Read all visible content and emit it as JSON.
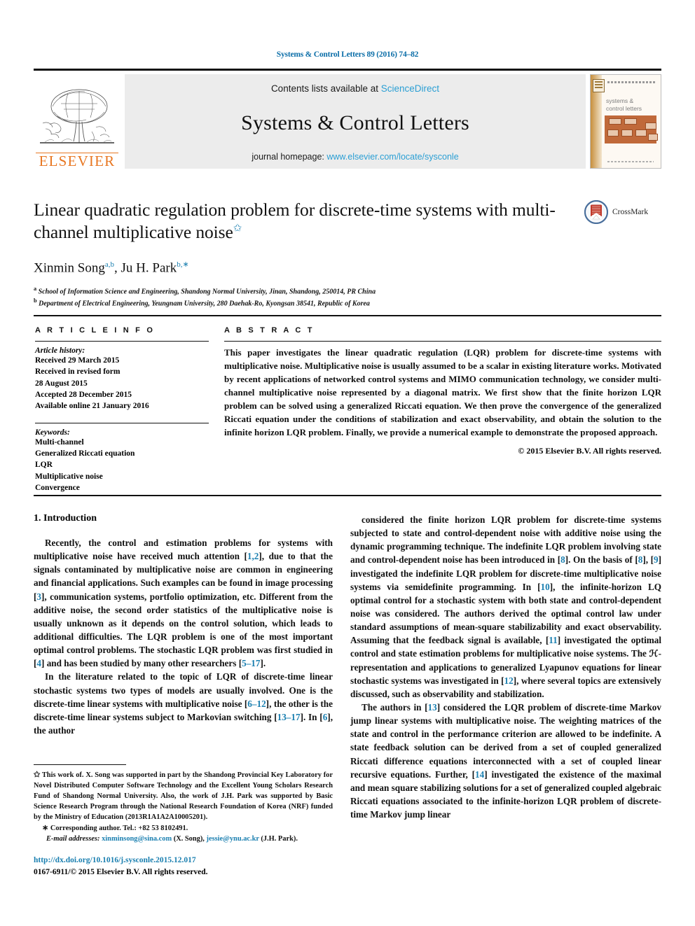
{
  "running_head": "Systems & Control Letters 89 (2016) 74–82",
  "masthead": {
    "publisher_name": "ELSEVIER",
    "contents_prefix": "Contents lists available at ",
    "contents_link": "ScienceDirect",
    "journal_title": "Systems & Control Letters",
    "homepage_prefix": "journal homepage: ",
    "homepage_url": "www.elsevier.com/locate/sysconle",
    "cover_title_line1": "systems &",
    "cover_title_line2": "control letters"
  },
  "title": {
    "line1": "Linear quadratic regulation problem for discrete-time systems with",
    "line2": "multi-channel multiplicative noise",
    "star": "✩",
    "crossmark_label": "CrossMark"
  },
  "authors": {
    "name1": "Xinmin Song",
    "sup1": "a,b",
    "separator": ", ",
    "name2": "Ju H. Park",
    "sup2": "b,",
    "sup2_star": "∗",
    "affiliation_a_marker": "a",
    "affiliation_a": "School of Information Science and Engineering, Shandong Normal University, Jinan, Shandong, 250014, PR China",
    "affiliation_b_marker": "b",
    "affiliation_b": "Department of Electrical Engineering, Yeungnam University, 280 Daehak-Ro, Kyongsan 38541, Republic of Korea"
  },
  "article_info": {
    "heading": "A R T I C L E    I N F O",
    "history_title": "Article history:",
    "history": [
      "Received 29 March 2015",
      "Received in revised form",
      "28 August 2015",
      "Accepted 28 December 2015",
      "Available online 21 January 2016"
    ],
    "keywords_title": "Keywords:",
    "keywords": [
      "Multi-channel",
      "Generalized Riccati equation",
      "LQR",
      "Multiplicative noise",
      "Convergence"
    ]
  },
  "abstract": {
    "heading": "A B S T R A C T",
    "text": "This paper investigates the linear quadratic regulation (LQR) problem for discrete-time systems with multiplicative noise. Multiplicative noise is usually assumed to be a scalar in existing literature works. Motivated by recent applications of networked control systems and MIMO communication technology, we consider multi-channel multiplicative noise represented by a diagonal matrix. We first show that the finite horizon LQR problem can be solved using a generalized Riccati equation. We then prove the convergence of the generalized Riccati equation under the conditions of stabilization and exact observability, and obtain the solution to the infinite horizon LQR problem. Finally, we provide a numerical example to demonstrate the proposed approach.",
    "copyright": "© 2015 Elsevier B.V. All rights reserved."
  },
  "body": {
    "section_title": "1. Introduction",
    "left_paragraphs": [
      {
        "segments": [
          {
            "t": "Recently, the control and estimation problems for systems with multiplicative noise have received much attention ["
          },
          {
            "t": "1,2",
            "ref": true
          },
          {
            "t": "], due to that the signals contaminated by multiplicative noise are common in engineering and financial applications. Such examples can be found in image processing ["
          },
          {
            "t": "3",
            "ref": true
          },
          {
            "t": "], communication systems, portfolio optimization, etc. Different from the additive noise, the second order statistics of the multiplicative noise is usually unknown as it depends on the control solution, which leads to additional difficulties. The LQR problem is one of the most important optimal control problems. The stochastic LQR problem was first studied in ["
          },
          {
            "t": "4",
            "ref": true
          },
          {
            "t": "] and has been studied by many other researchers ["
          },
          {
            "t": "5–17",
            "ref": true
          },
          {
            "t": "]."
          }
        ]
      },
      {
        "segments": [
          {
            "t": "In the literature related to the topic of LQR of discrete-time linear stochastic systems two types of models are usually involved. One is the discrete-time linear systems with multiplicative noise ["
          },
          {
            "t": "6–12",
            "ref": true
          },
          {
            "t": "], the other is the discrete-time linear systems subject to Markovian switching ["
          },
          {
            "t": "13–17",
            "ref": true
          },
          {
            "t": "]. In ["
          },
          {
            "t": "6",
            "ref": true
          },
          {
            "t": "], the  author"
          }
        ]
      }
    ],
    "right_paragraphs": [
      {
        "segments": [
          {
            "t": "considered the finite horizon LQR problem for discrete-time systems subjected to state and control-dependent noise with additive noise using the dynamic programming technique. The indefinite LQR problem involving state and control-dependent noise has been introduced in ["
          },
          {
            "t": "8",
            "ref": true
          },
          {
            "t": "]. On the basis of ["
          },
          {
            "t": "8",
            "ref": true
          },
          {
            "t": "], ["
          },
          {
            "t": "9",
            "ref": true
          },
          {
            "t": "] investigated the indefinite LQR problem for discrete-time multiplicative noise systems via semidefinite programming. In ["
          },
          {
            "t": "10",
            "ref": true
          },
          {
            "t": "], the infinite-horizon LQ optimal control for a stochastic system with both state and control-dependent noise was considered. The authors derived the optimal control law under standard assumptions of mean-square stabilizability and exact observability. Assuming that the feedback signal is available, ["
          },
          {
            "t": "11",
            "ref": true
          },
          {
            "t": "] investigated the optimal control and state estimation problems for multiplicative noise systems. The ℋ-representation and applications to generalized Lyapunov equations for linear stochastic systems was investigated in ["
          },
          {
            "t": "12",
            "ref": true
          },
          {
            "t": "], where several topics are extensively discussed, such as observability and stabilization."
          }
        ],
        "no_indent": false
      },
      {
        "segments": [
          {
            "t": "The authors in ["
          },
          {
            "t": "13",
            "ref": true
          },
          {
            "t": "] considered the LQR problem of discrete-time Markov jump linear systems with multiplicative noise. The weighting matrices of the state and control in the performance criterion are allowed to be indefinite. A state feedback solution can be derived from a set of coupled generalized Riccati difference equations interconnected with a set of coupled linear recursive equations. Further, ["
          },
          {
            "t": "14",
            "ref": true
          },
          {
            "t": "] investigated the existence of the maximal and mean square stabilizing solutions for a set of generalized coupled algebraic Riccati equations associated to the infinite-horizon LQR problem of discrete-time Markov jump linear"
          }
        ]
      }
    ]
  },
  "footnotes": {
    "funding_marker": "✩",
    "funding": "This work of. X. Song was supported in part by the Shandong Provincial Key Laboratory for Novel Distributed Computer Software Technology and the Excellent Young Scholars Research Fund of Shandong Normal University. Also, the work of J.H. Park was supported by Basic Science Research Program through the National Research Foundation of Korea (NRF) funded by the Ministry of Education (2013R1A1A2A10005201).",
    "corresponding_marker": "∗",
    "corresponding": "Corresponding author. Tel.: +82 53 8102491.",
    "email_label": "E-mail addresses:",
    "email1": "xinminsong@sina.com",
    "email1_owner": "(X. Song),",
    "email2": "jessie@ynu.ac.kr",
    "email2_owner": "(J.H. Park)."
  },
  "doi_block": {
    "doi": "http://dx.doi.org/10.1016/j.sysconle.2015.12.017",
    "issn_line": "0167-6911/© 2015 Elsevier B.V. All rights reserved."
  },
  "colors": {
    "link": "#1a7fb0",
    "science_direct": "#2b9fd4",
    "elsevier_orange": "#E87722",
    "masthead_bg": "#ececec"
  }
}
